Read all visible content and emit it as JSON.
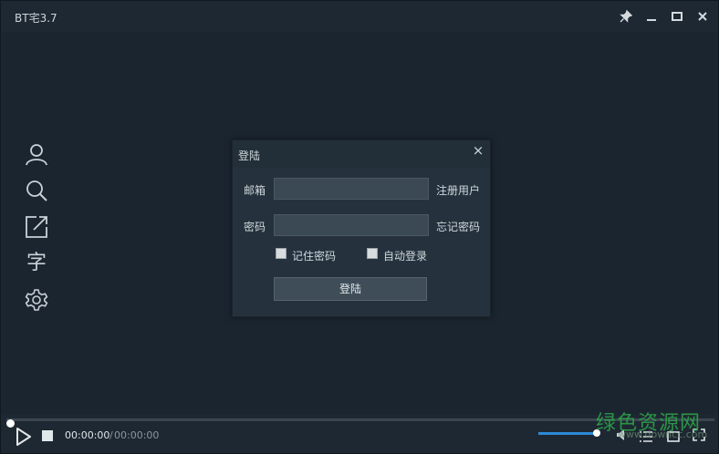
{
  "app": {
    "title": "BT宅3.7"
  },
  "window_controls": [
    "pin-icon",
    "minimize-icon",
    "maximize-icon",
    "close-icon"
  ],
  "sidebar": {
    "icons": [
      "user-icon",
      "search-icon",
      "share-icon",
      "subtitle-icon",
      "settings-icon"
    ],
    "subtitle_glyph": "字"
  },
  "login": {
    "title": "登陆",
    "close_glyph": "×",
    "email_label": "邮箱",
    "email_value": "",
    "register_link": "注册用户",
    "password_label": "密码",
    "password_value": "",
    "forgot_link": "忘记密码",
    "remember_label": "记住密码",
    "remember_checked": false,
    "autologin_label": "自动登录",
    "autologin_checked": false,
    "submit_label": "登陆"
  },
  "player": {
    "current_time": "00:00:00",
    "separator": "/",
    "total_time": "00:00:00",
    "progress": 0,
    "volume": 1.0
  },
  "watermark": {
    "text": "绿色资源网",
    "url": "www.downcc.com"
  },
  "colors": {
    "accent": "#2d8ad6",
    "background": "#1c2630",
    "watermark": "#2ea84a"
  }
}
